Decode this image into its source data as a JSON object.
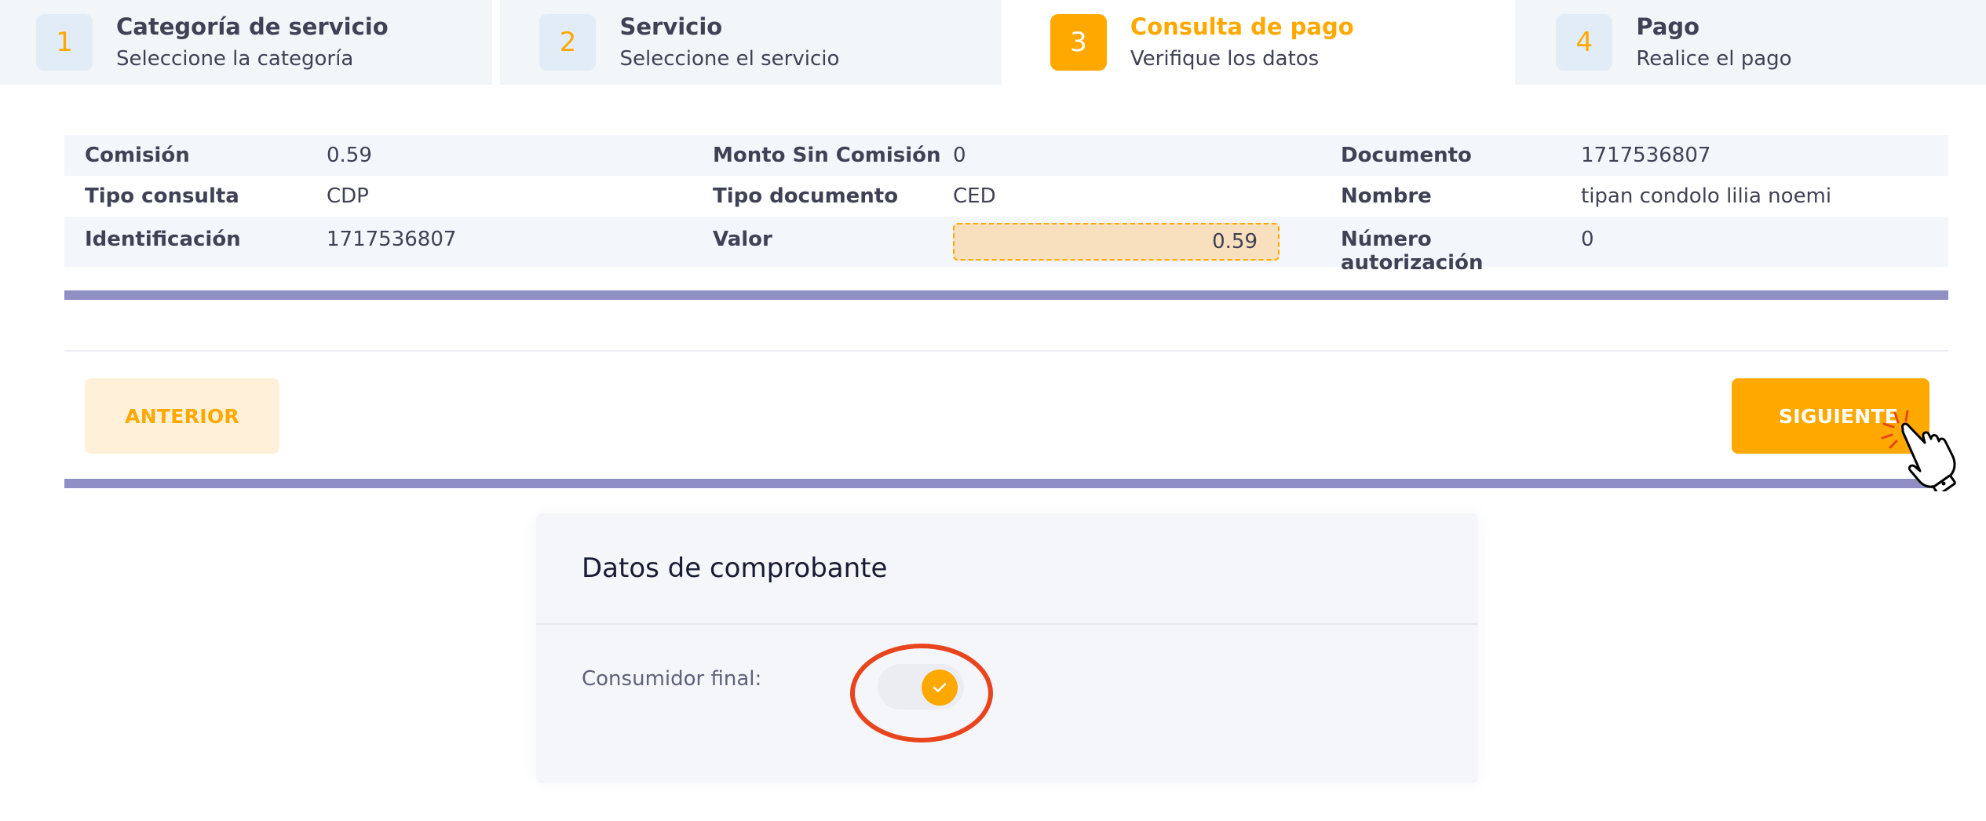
{
  "stepper": [
    {
      "number": "1",
      "title": "Categoría de servicio",
      "subtitle": "Seleccione la categoría"
    },
    {
      "number": "2",
      "title": "Servicio",
      "subtitle": "Seleccione el servicio"
    },
    {
      "number": "3",
      "title": "Consulta de pago",
      "subtitle": "Verifique los datos"
    },
    {
      "number": "4",
      "title": "Pago",
      "subtitle": "Realice el pago"
    }
  ],
  "details": {
    "comision_label": "Comisión",
    "comision_value": "0.59",
    "monto_label": "Monto Sin Comisión",
    "monto_value": "0",
    "documento_label": "Documento",
    "documento_value": "1717536807",
    "tipo_consulta_label": "Tipo consulta",
    "tipo_consulta_value": "CDP",
    "tipo_documento_label": "Tipo documento",
    "tipo_documento_value": "CED",
    "nombre_label": "Nombre",
    "nombre_value": "tipan condolo lilia noemi",
    "identificacion_label": "Identificación",
    "identificacion_value": "1717536807",
    "valor_label": "Valor",
    "valor_value": "0.59",
    "autorizacion_label": "Número autorización",
    "autorizacion_value": "0"
  },
  "buttons": {
    "prev_label": "ANTERIOR",
    "next_label": "SIGUIENTE"
  },
  "card": {
    "title": "Datos de comprobante",
    "consumidor_label": "Consumidor final:",
    "consumidor_checked": true
  },
  "colors": {
    "accent": "#ffa800",
    "bar": "#8f8fc6",
    "highlight_ring": "#e8451e"
  },
  "icons": {
    "toggle_knob": "check-icon",
    "cursor": "hand-pointer-icon"
  }
}
